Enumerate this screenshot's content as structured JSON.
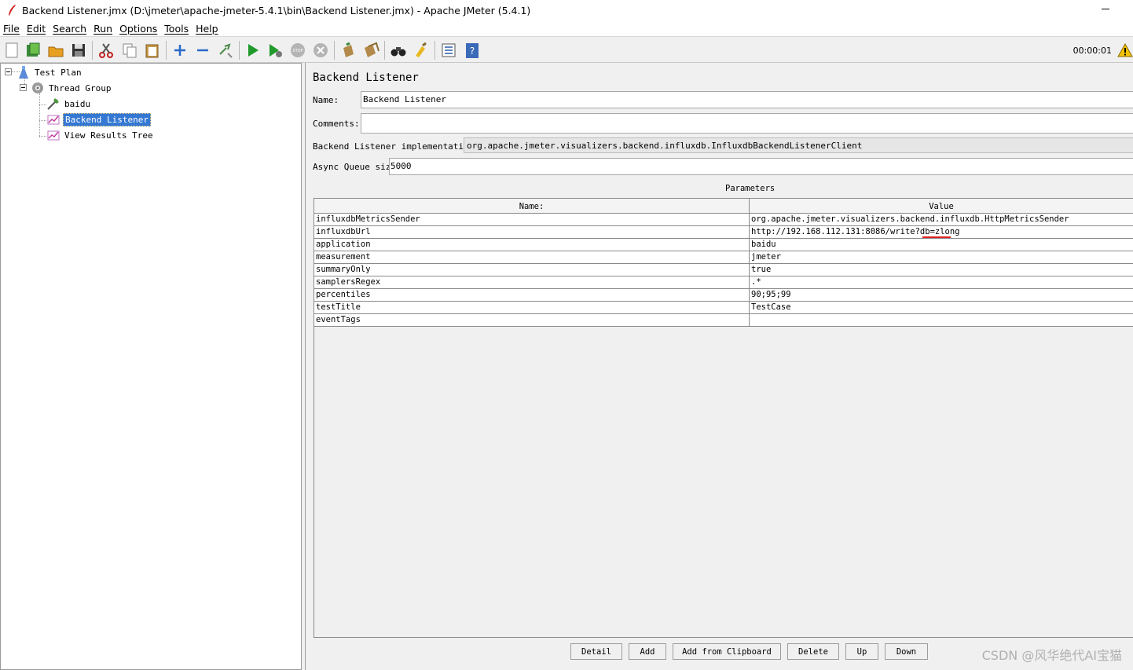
{
  "window": {
    "title": "Backend Listener.jmx (D:\\jmeter\\apache-jmeter-5.4.1\\bin\\Backend Listener.jmx) - Apache JMeter (5.4.1)"
  },
  "menu": [
    "File",
    "Edit",
    "Search",
    "Run",
    "Options",
    "Tools",
    "Help"
  ],
  "toolbar": {
    "icons": [
      "new-icon",
      "templates-icon",
      "open-icon",
      "save-icon",
      "cut-icon",
      "copy-icon",
      "paste-icon",
      "expand-icon",
      "collapse-icon",
      "toggle-icon",
      "start-icon",
      "start-no-pause-icon",
      "stop-icon",
      "shutdown-icon",
      "clear-icon",
      "clear-all-icon",
      "search-icon",
      "reset-search-icon",
      "function-helper-icon",
      "help-icon"
    ],
    "timer": "00:00:01"
  },
  "tree": {
    "items": [
      {
        "label": "Test Plan",
        "icon": "test-plan-icon"
      },
      {
        "label": "Thread Group",
        "icon": "thread-group-icon"
      },
      {
        "label": "baidu",
        "icon": "sampler-icon"
      },
      {
        "label": "Backend Listener",
        "icon": "listener-icon",
        "selected": true
      },
      {
        "label": "View Results Tree",
        "icon": "listener-icon"
      }
    ]
  },
  "panel": {
    "title": "Backend Listener",
    "name_label": "Name:",
    "name_value": "Backend Listener",
    "comments_label": "Comments:",
    "comments_value": "",
    "impl_label": "Backend Listener implementation",
    "impl_value": "org.apache.jmeter.visualizers.backend.influxdb.InfluxdbBackendListenerClient",
    "queue_label": "Async Queue size",
    "queue_value": "5000",
    "params_title": "Parameters"
  },
  "table": {
    "headers": [
      "Name:",
      "Value"
    ],
    "rows": [
      [
        "influxdbMetricsSender",
        "org.apache.jmeter.visualizers.backend.influxdb.HttpMetricsSender"
      ],
      [
        "influxdbUrl",
        "http://192.168.112.131:8086/write?db=zlong"
      ],
      [
        "application",
        "baidu"
      ],
      [
        "measurement",
        "jmeter"
      ],
      [
        "summaryOnly",
        "true"
      ],
      [
        "samplersRegex",
        ".*"
      ],
      [
        "percentiles",
        "90;95;99"
      ],
      [
        "testTitle",
        "TestCase"
      ],
      [
        "eventTags",
        ""
      ]
    ]
  },
  "buttons": {
    "detail": "Detail",
    "add": "Add",
    "add_clipboard": "Add from Clipboard",
    "delete": "Delete",
    "up": "Up",
    "down": "Down"
  },
  "watermark": "CSDN @风华绝代AI宝猫",
  "colors": {
    "selection": "#3478d3",
    "start": "#1f9a2b",
    "annotation": "#e02020"
  }
}
